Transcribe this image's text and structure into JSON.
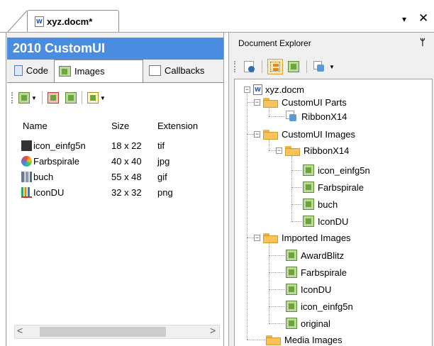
{
  "document_tab": {
    "title": "xyz.docm*",
    "menu_glyph": "▾",
    "close_glyph": "✕"
  },
  "left_panel": {
    "title": "2010 CustomUI",
    "tabs": [
      {
        "label": "Code",
        "icon": "code-icon"
      },
      {
        "label": "Images",
        "icon": "image-icon",
        "selected": true
      },
      {
        "label": "Callbacks",
        "icon": "callbacks-icon"
      }
    ],
    "toolbar_icons": [
      "add-image-icon",
      "remove-image-icon",
      "import-image-icon",
      "view-mode-icon"
    ],
    "list": {
      "columns": [
        "Name",
        "Size",
        "Extension"
      ],
      "rows": [
        {
          "name": "icon_einfg5n",
          "size": "18 x 22",
          "ext": "tif",
          "icon": "clipboard-icon"
        },
        {
          "name": "Farbspirale",
          "size": "40 x 40",
          "ext": "jpg",
          "icon": "color-spiral-icon"
        },
        {
          "name": "buch",
          "size": "55 x 48",
          "ext": "gif",
          "icon": "books-icon"
        },
        {
          "name": "IconDU",
          "size": "32 x 32",
          "ext": "png",
          "icon": "bar-chart-icon"
        }
      ]
    },
    "scrollbar": {
      "left": "<",
      "right": ">"
    }
  },
  "right_panel": {
    "title": "Document Explorer",
    "pin_glyph": "ᛘ",
    "toolbar_icons": [
      "info-icon",
      "tree-view-icon",
      "image-view-icon",
      "ribbon-icon"
    ],
    "tree": {
      "root": "xyz.docm",
      "customui_parts": {
        "label": "CustomUI Parts",
        "items": [
          "RibbonX14"
        ]
      },
      "customui_images": {
        "label": "CustomUI Images",
        "sub": {
          "label": "RibbonX14",
          "items": [
            "icon_einfg5n",
            "Farbspirale",
            "buch",
            "IconDU"
          ]
        }
      },
      "imported_images": {
        "label": "Imported Images",
        "items": [
          "AwardBlitz",
          "Farbspirale",
          "IconDU",
          "icon_einfg5n",
          "original"
        ]
      },
      "media_images": {
        "label": "Media Images"
      }
    }
  },
  "colors": {
    "title_bar": "#4a8ce0",
    "folder": "#f7c35d",
    "accent_button": "#fde7b3"
  }
}
